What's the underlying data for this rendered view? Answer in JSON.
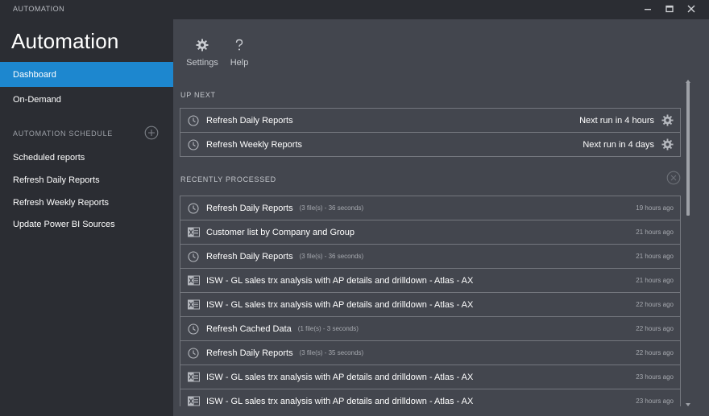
{
  "window": {
    "title": "AUTOMATION",
    "controls": [
      "minimize-icon",
      "maximize-icon",
      "close-icon"
    ]
  },
  "sidebar": {
    "app_title": "Automation",
    "nav": [
      {
        "label": "Dashboard",
        "active": true
      },
      {
        "label": "On-Demand",
        "active": false
      }
    ],
    "schedule_header": "AUTOMATION SCHEDULE",
    "add_icon": "plus-circle-icon",
    "schedule_items": [
      {
        "label": "Scheduled reports"
      },
      {
        "label": "Refresh Daily Reports"
      },
      {
        "label": "Refresh Weekly Reports"
      },
      {
        "label": "Update Power BI Sources"
      }
    ]
  },
  "toolbar": {
    "settings_label": "Settings",
    "help_label": "Help",
    "settings_icon": "gear-icon",
    "help_icon": "question-icon"
  },
  "up_next": {
    "title": "UP NEXT",
    "items": [
      {
        "icon": "clock-icon",
        "name": "Refresh Daily Reports",
        "next_run": "Next run in 4 hours"
      },
      {
        "icon": "clock-icon",
        "name": "Refresh Weekly Reports",
        "next_run": "Next run in 4 days"
      }
    ]
  },
  "recent": {
    "title": "RECENTLY PROCESSED",
    "clear_icon": "clear-circle-icon",
    "items": [
      {
        "icon": "clock-icon",
        "name": "Refresh Daily Reports",
        "detail": "(3 file(s) - 36 seconds)",
        "time": "19 hours ago"
      },
      {
        "icon": "excel-icon",
        "name": "Customer list by Company and Group",
        "detail": "",
        "time": "21 hours ago"
      },
      {
        "icon": "clock-icon",
        "name": "Refresh Daily Reports",
        "detail": "(3 file(s) - 36 seconds)",
        "time": "21 hours ago"
      },
      {
        "icon": "excel-icon",
        "name": "ISW - GL sales trx analysis with AP details and drilldown - Atlas - AX",
        "detail": "",
        "time": "21 hours ago"
      },
      {
        "icon": "excel-icon",
        "name": "ISW - GL sales trx analysis with AP details and drilldown - Atlas - AX",
        "detail": "",
        "time": "22 hours ago"
      },
      {
        "icon": "clock-icon",
        "name": "Refresh Cached Data",
        "detail": "(1 file(s) - 3 seconds)",
        "time": "22 hours ago"
      },
      {
        "icon": "clock-icon",
        "name": "Refresh Daily Reports",
        "detail": "(3 file(s) - 35 seconds)",
        "time": "22 hours ago"
      },
      {
        "icon": "excel-icon",
        "name": "ISW - GL sales trx analysis with AP details and drilldown - Atlas - AX",
        "detail": "",
        "time": "23 hours ago"
      },
      {
        "icon": "excel-icon",
        "name": "ISW - GL sales trx analysis with AP details and drilldown - Atlas - AX",
        "detail": "",
        "time": "23 hours ago"
      }
    ]
  },
  "colors": {
    "accent": "#1d87cf",
    "sidebar_bg": "#2b2d33",
    "content_bg": "#43464e",
    "border": "#74777e"
  }
}
